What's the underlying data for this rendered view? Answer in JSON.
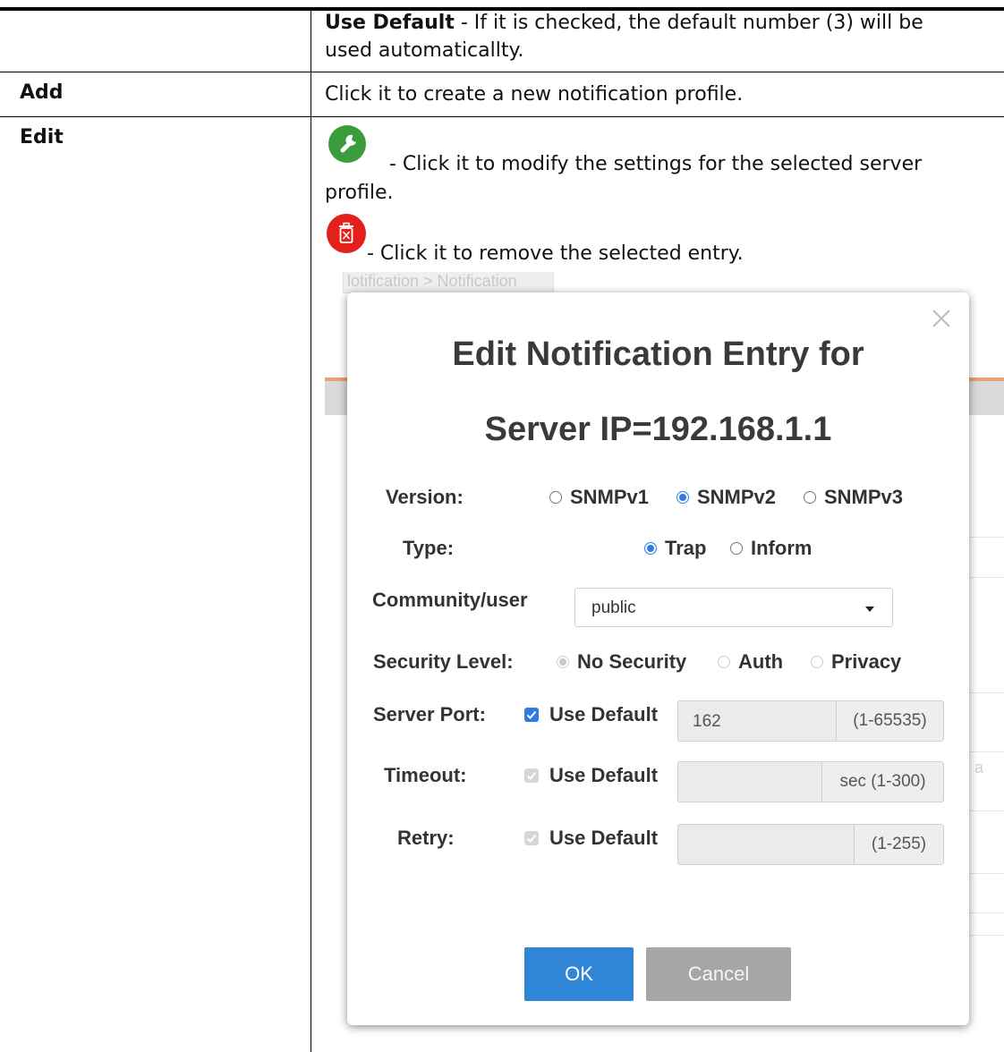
{
  "table": {
    "row1": {
      "desc_bold": "Use Default",
      "desc_line1": " - If it is checked, the default number (3) will be",
      "desc_line2": "used automaticallty."
    },
    "row2": {
      "term": "Add",
      "desc": "Click it to create a new notification profile."
    },
    "row3": {
      "term": "Edit",
      "edit_line1": "- Click it to modify the settings for the selected server",
      "edit_line2": "profile.",
      "delete_desc": "- Click it to remove the selected entry."
    }
  },
  "icons": {
    "edit": "wrench-icon",
    "delete": "trash-icon",
    "close": "close-icon",
    "edit_color": "#3a9c3a",
    "delete_color": "#e2211c"
  },
  "screenshot": {
    "breadcrumb": "lotification > Notification",
    "modal": {
      "title_line1": "Edit Notification Entry for",
      "title_line2": "Server IP=192.168.1.1",
      "version": {
        "label": "Version:",
        "options": [
          "SNMPv1",
          "SNMPv2",
          "SNMPv3"
        ],
        "selected": "SNMPv2"
      },
      "type": {
        "label": "Type:",
        "options": [
          "Trap",
          "Inform"
        ],
        "selected": "Trap"
      },
      "community": {
        "label": "Community/user",
        "value": "public"
      },
      "security": {
        "label": "Security Level:",
        "options": [
          "No Security",
          "Auth",
          "Privacy"
        ],
        "selected": "No Security"
      },
      "server_port": {
        "label": "Server Port:",
        "use_default": "Use Default",
        "value": "162",
        "range": "(1-65535)"
      },
      "timeout": {
        "label": "Timeout:",
        "use_default": "Use Default",
        "value": "",
        "range": "sec (1-300)"
      },
      "retry": {
        "label": "Retry:",
        "use_default": "Use Default",
        "value": "",
        "range": "(1-255)"
      },
      "ok_label": "OK",
      "cancel_label": "Cancel"
    },
    "ghost_text": "a"
  }
}
